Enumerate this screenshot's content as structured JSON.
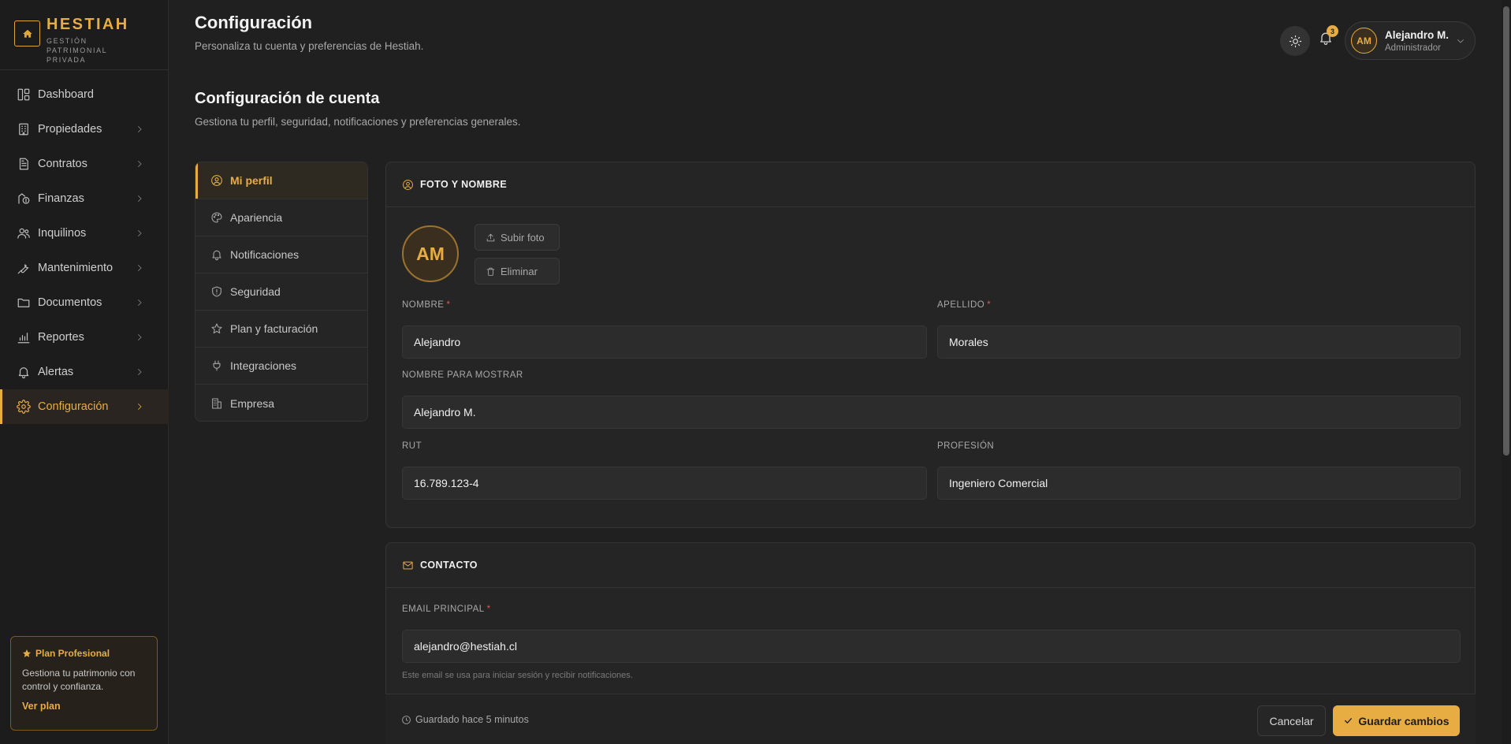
{
  "brand": {
    "name": "HESTIAH",
    "subtitle": "GESTIÓN PATRIMONIAL PRIVADA",
    "logo_icon": "house-icon"
  },
  "sidebar": {
    "items": [
      {
        "label": "Dashboard",
        "icon": "dashboard-icon"
      },
      {
        "label": "Propiedades",
        "icon": "building-icon"
      },
      {
        "label": "Contratos",
        "icon": "document-icon"
      },
      {
        "label": "Finanzas",
        "icon": "finance-icon"
      },
      {
        "label": "Inquilinos",
        "icon": "users-icon"
      },
      {
        "label": "Mantenimiento",
        "icon": "wrench-icon"
      },
      {
        "label": "Documentos",
        "icon": "folder-icon"
      },
      {
        "label": "Reportes",
        "icon": "bar-chart-icon"
      },
      {
        "label": "Alertas",
        "icon": "bell-icon"
      },
      {
        "label": "Configuración",
        "icon": "gear-icon",
        "active": true
      }
    ],
    "plan": {
      "title": "Plan Profesional",
      "description": "Gestiona tu patrimonio con control y confianza.",
      "link": "Ver plan"
    }
  },
  "header": {
    "title": "Configuración",
    "subtitle": "Personaliza tu cuenta y preferencias de Hestiah.",
    "notifications_count": "3",
    "user": {
      "initials": "AM",
      "name": "Alejandro M.",
      "role": "Administrador"
    }
  },
  "section": {
    "title": "Configuración de cuenta",
    "subtitle": "Gestiona tu perfil, seguridad, notificaciones y preferencias generales."
  },
  "settings_menu": [
    {
      "label": "Mi perfil",
      "icon": "user-circle-icon",
      "active": true
    },
    {
      "label": "Apariencia",
      "icon": "palette-icon"
    },
    {
      "label": "Notificaciones",
      "icon": "bell-icon"
    },
    {
      "label": "Seguridad",
      "icon": "shield-icon"
    },
    {
      "label": "Plan y facturación",
      "icon": "star-icon"
    },
    {
      "label": "Integraciones",
      "icon": "plug-icon"
    },
    {
      "label": "Empresa",
      "icon": "company-icon"
    }
  ],
  "photo_card": {
    "title": "FOTO Y NOMBRE",
    "avatar_initials": "AM",
    "upload_label": "Subir foto",
    "delete_label": "Eliminar",
    "fields": {
      "nombre": {
        "label": "NOMBRE",
        "value": "Alejandro",
        "required": "*"
      },
      "apellido": {
        "label": "APELLIDO",
        "value": "Morales",
        "required": "*"
      },
      "display_name": {
        "label": "NOMBRE PARA MOSTRAR",
        "value": "Alejandro M."
      },
      "rut": {
        "label": "RUT",
        "value": "16.789.123-4"
      },
      "profesion": {
        "label": "PROFESIÓN",
        "value": "Ingeniero Comercial"
      }
    }
  },
  "contact_card": {
    "title": "CONTACTO",
    "email": {
      "label": "EMAIL PRINCIPAL",
      "required": "*",
      "value": "alejandro@hestiah.cl",
      "hint": "Este email se usa para iniciar sesión y recibir notificaciones."
    }
  },
  "footer": {
    "saved_text": "Guardado hace 5 minutos",
    "cancel_label": "Cancelar",
    "save_label": "Guardar cambios"
  },
  "colors": {
    "accent": "#e8ad42",
    "background": "#202020",
    "sidebar": "#1c1c1c",
    "card": "#252525",
    "required": "#e05555"
  }
}
